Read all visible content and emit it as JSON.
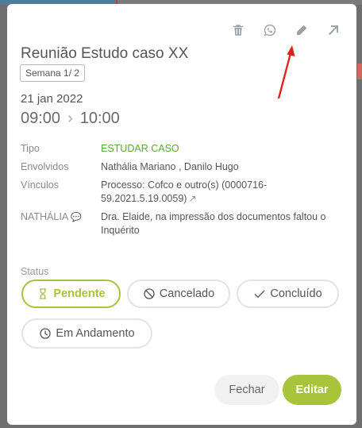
{
  "event": {
    "title": "Reunião Estudo caso XX",
    "week_badge": "Semana 1/ 2",
    "date": "21 jan 2022",
    "start_time": "09:00",
    "end_time": "10:00"
  },
  "details": {
    "tipo_label": "Tipo",
    "tipo_value": "ESTUDAR CASO",
    "envolvidos_label": "Envolvidos",
    "envolvidos_value": "Nathália Mariano , Danilo Hugo",
    "vinculos_label": "Vínculos",
    "vinculos_value": "Processo: Cofco e outro(s) (0000716-59.2021.5.19.0059)",
    "comment_author": "NATHÁLIA",
    "comment_text": "Dra. Elaide, na impressão dos documentos faltou o Inquérito"
  },
  "status": {
    "label": "Status",
    "pendente": "Pendente",
    "cancelado": "Cancelado",
    "concluido": "Concluído",
    "em_andamento": "Em Andamento",
    "selected": "Pendente"
  },
  "footer": {
    "close_label": "Fechar",
    "edit_label": "Editar"
  },
  "colors": {
    "accent": "#a7c43a",
    "tipo_green": "#5aa63a",
    "annotation_arrow": "#e0241b"
  },
  "icons": [
    "trash-icon",
    "whatsapp-icon",
    "pencil-icon",
    "expand-arrow-icon",
    "external-link-icon",
    "comment-icon",
    "hourglass-icon",
    "ban-icon",
    "check-icon",
    "clock-icon"
  ]
}
